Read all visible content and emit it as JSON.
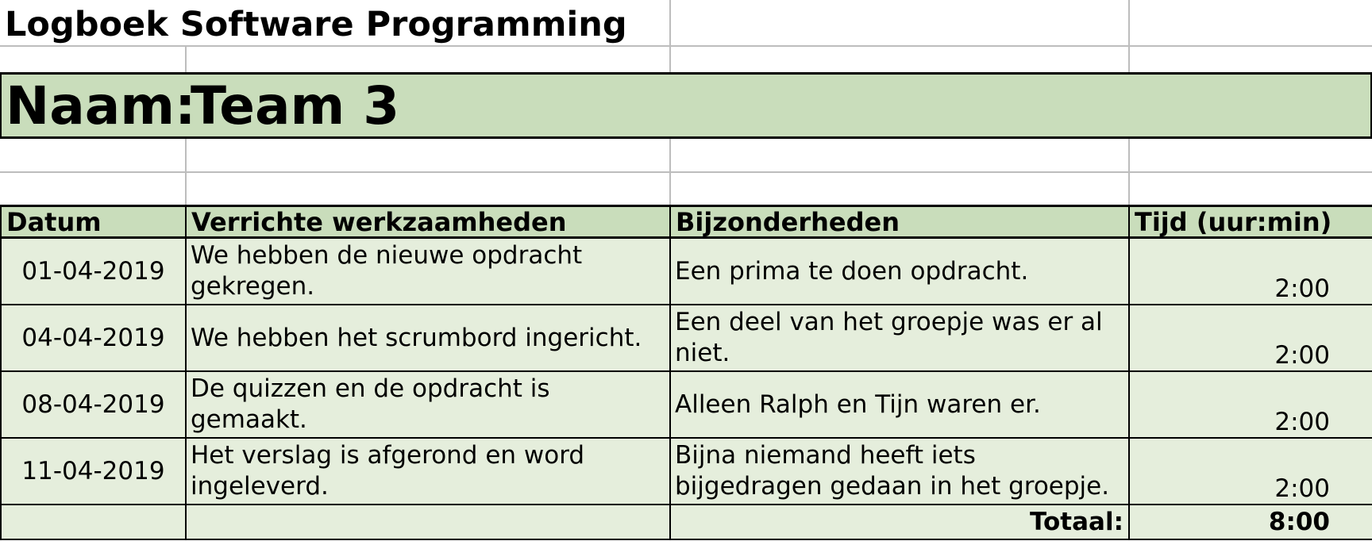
{
  "document": {
    "title": "Logboek Software Programming",
    "name_label": "Naam:",
    "name_value": "Team 3"
  },
  "table": {
    "headers": [
      "Datum",
      "Verrichte werkzaamheden",
      "Bijzonderheden",
      "Tijd (uur:min)"
    ],
    "rows": [
      {
        "date": "01-04-2019",
        "work": "We hebben de nieuwe opdracht gekregen.",
        "notes": "Een prima te doen opdracht.",
        "time": "2:00"
      },
      {
        "date": "04-04-2019",
        "work": "We hebben het scrumbord ingericht.",
        "notes": "Een deel van het groepje was er al niet.",
        "time": "2:00"
      },
      {
        "date": "08-04-2019",
        "work": "De quizzen en de opdracht is gemaakt.",
        "notes": "Alleen Ralph en Tijn waren er.",
        "time": "2:00"
      },
      {
        "date": "11-04-2019",
        "work": "Het verslag is afgerond en word ingeleverd.",
        "notes": "Bijna niemand heeft iets bijgedragen gedaan in het groepje.",
        "time": "2:00"
      }
    ],
    "total_label": "Totaal:",
    "total_value": "8:00"
  },
  "colors": {
    "header_fill": "#c9ddbb",
    "row_fill": "#e5eedc",
    "grid": "#bdbdbd",
    "border": "#000000"
  }
}
